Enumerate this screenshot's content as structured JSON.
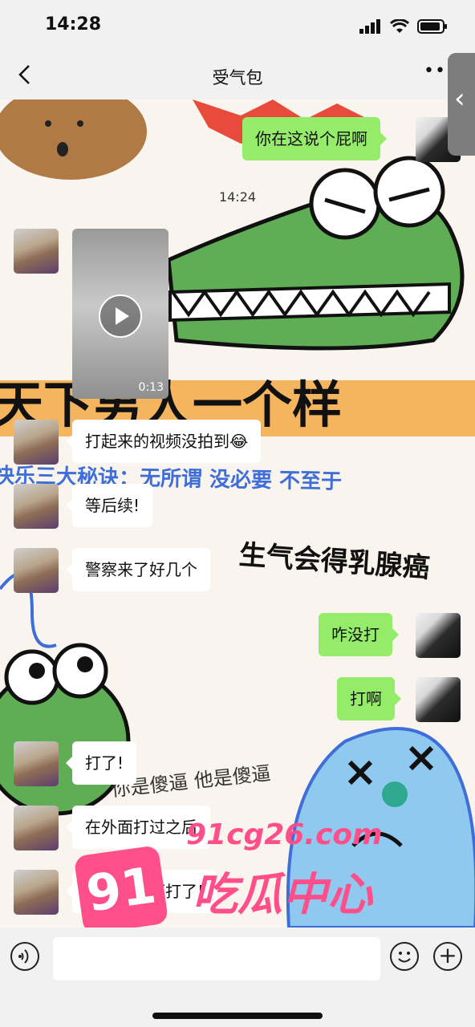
{
  "status_bar": {
    "time": "14:28"
  },
  "header": {
    "title": "受气包",
    "more": "••"
  },
  "side_tab": {
    "glyph": "‹"
  },
  "chat": {
    "time_label": "14:24",
    "video_duration": "0:13",
    "sticker_text": {
      "top_big": "天下男人一个样",
      "mid_line": "快乐三大秘诀：无所谓 没必要 不至于",
      "right_line": "生气会得乳腺癌",
      "scribble": "你是傻逼 他是傻逼"
    },
    "messages": [
      {
        "side": "right",
        "text": "你在这说个屁啊"
      },
      {
        "side": "left",
        "text": "打起来的视频没拍到😂"
      },
      {
        "side": "left",
        "text": "等后续!"
      },
      {
        "side": "left",
        "text": "警察来了好几个"
      },
      {
        "side": "right",
        "text": "咋没打"
      },
      {
        "side": "right",
        "text": "打啊"
      },
      {
        "side": "left",
        "text": "打了!"
      },
      {
        "side": "left",
        "text": "在外面打过之后"
      },
      {
        "side": "left",
        "text": "又在店里面打了!"
      }
    ]
  },
  "watermark": {
    "badge": "91",
    "url": "91cg26.com",
    "name": "吃瓜中心"
  },
  "input_bar": {
    "placeholder": ""
  },
  "colors": {
    "bubble_me": "#95ec69",
    "bubble_other": "#ffffff",
    "watermark": "#ff4f8a"
  }
}
